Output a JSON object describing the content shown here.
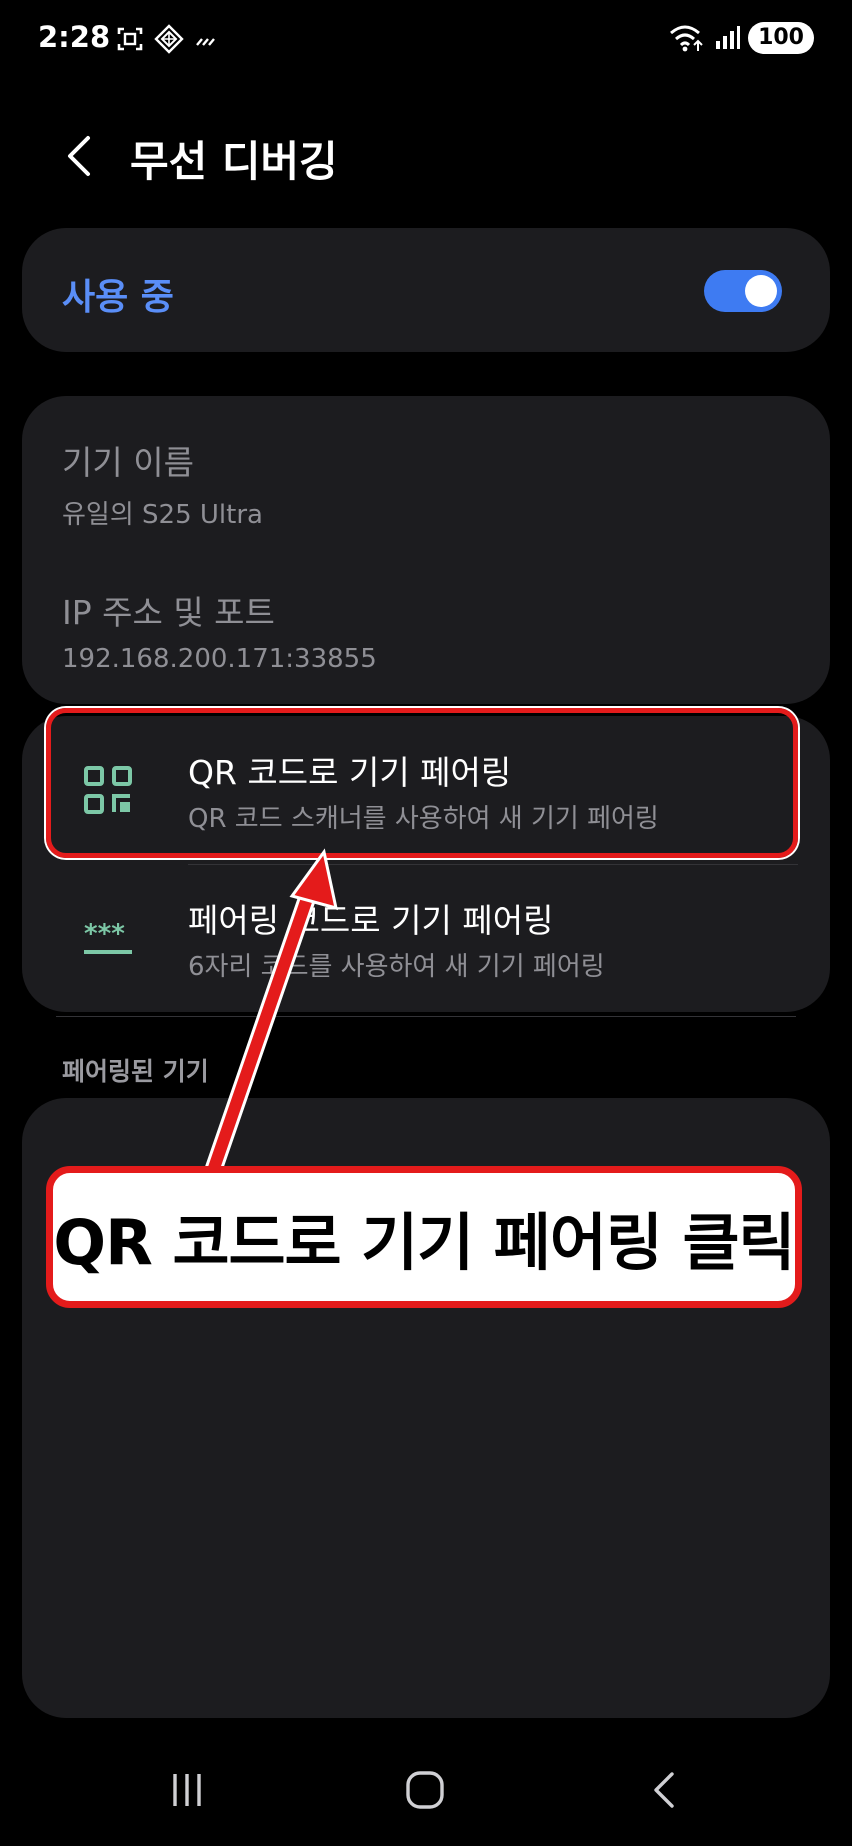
{
  "status_bar": {
    "time": "2:28",
    "battery": "100",
    "icons": [
      "screenshot-icon",
      "vpn-diamond-icon",
      "data-wave-icon",
      "wifi-icon",
      "signal-icon"
    ]
  },
  "header": {
    "title": "무선 디버깅",
    "back_icon": "chevron-left-icon"
  },
  "toggle": {
    "label": "사용 중",
    "enabled": true,
    "accent_color": "#3e7bf2"
  },
  "device_info": {
    "name_title": "기기 이름",
    "name_value": "유일의 S25 Ultra",
    "ip_title": "IP 주소 및 포트",
    "ip_value": "192.168.200.171:33855"
  },
  "pairing_options": [
    {
      "title": "QR 코드로 기기 페어링",
      "subtitle": "QR 코드 스캐너를 사용하여 새 기기 페어링",
      "icon": "qr-code-icon"
    },
    {
      "title": "페어링 코드로 기기 페어링",
      "subtitle": "6자리 코드를 사용하여 새 기기 페어링",
      "icon": "asterisk-code-icon"
    }
  ],
  "paired_devices": {
    "section_label": "페어링된 기기"
  },
  "annotation": {
    "callout_text": "QR 코드로 기기 페어링 클릭",
    "highlight_color": "#e41b1b"
  },
  "nav_bar": {
    "icons": [
      "recents-icon",
      "home-icon",
      "back-icon"
    ]
  }
}
